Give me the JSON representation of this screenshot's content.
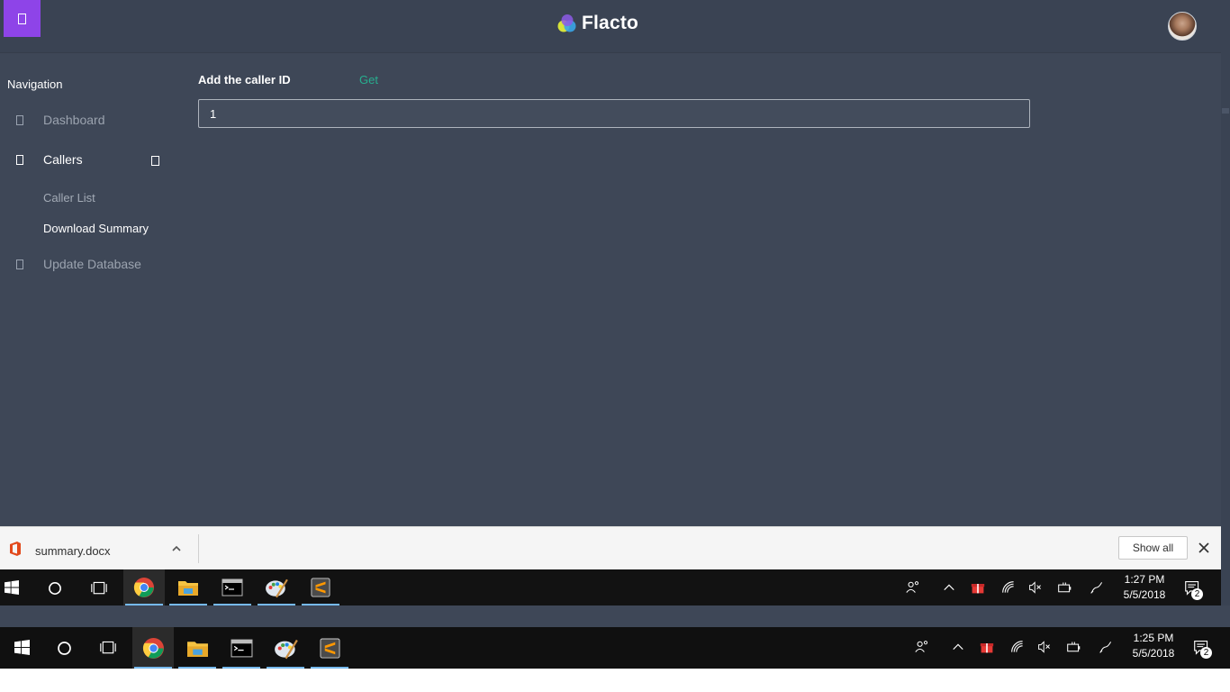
{
  "app": {
    "brand": "Flacto",
    "colors": {
      "accent": "#8e44e8",
      "link": "#27ae8f",
      "background": "#3e4757"
    }
  },
  "sidebar": {
    "heading": "Navigation",
    "items": [
      {
        "label": "Dashboard",
        "icon": "dashboard-icon"
      },
      {
        "label": "Callers",
        "icon": "callers-icon",
        "expanded": true
      },
      {
        "label": "Update Database",
        "icon": "database-icon"
      }
    ],
    "sub_items": [
      {
        "label": "Caller List"
      },
      {
        "label": "Download Summary"
      }
    ]
  },
  "main": {
    "label": "Add the caller ID",
    "get_link": "Get",
    "caller_id_value": "1"
  },
  "download_bar": {
    "file_name": "summary.docx",
    "show_all": "Show all"
  },
  "taskbars": [
    {
      "time": "1:27 PM",
      "date": "5/5/2018",
      "notification_count": "2"
    },
    {
      "time": "1:25 PM",
      "date": "5/5/2018",
      "notification_count": "2"
    }
  ]
}
